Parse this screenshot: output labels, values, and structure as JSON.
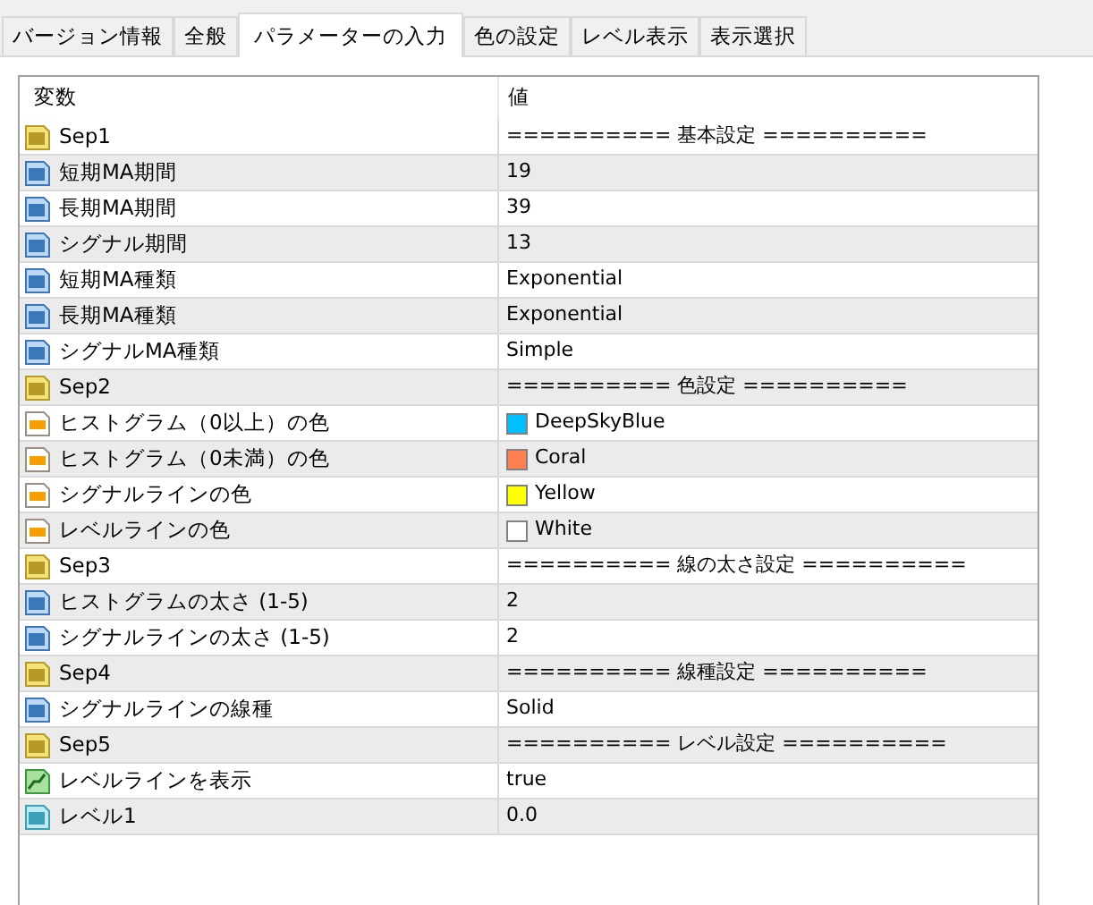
{
  "tabs": [
    {
      "label": "バージョン情報",
      "selected": false
    },
    {
      "label": "全般",
      "selected": false
    },
    {
      "label": "パラメーターの入力",
      "selected": true
    },
    {
      "label": "色の設定",
      "selected": false
    },
    {
      "label": "レベル表示",
      "selected": false
    },
    {
      "label": "表示選択",
      "selected": false
    }
  ],
  "table": {
    "columns": [
      "変数",
      "値"
    ],
    "rows": [
      {
        "kind": "string",
        "name": "Sep1",
        "value": "========== 基本設定 =========="
      },
      {
        "kind": "integer",
        "name": "短期MA期間",
        "value": "19"
      },
      {
        "kind": "integer",
        "name": "長期MA期間",
        "value": "39"
      },
      {
        "kind": "integer",
        "name": "シグナル期間",
        "value": "13"
      },
      {
        "kind": "integer",
        "name": "短期MA種類",
        "value": "Exponential"
      },
      {
        "kind": "integer",
        "name": "長期MA種類",
        "value": "Exponential"
      },
      {
        "kind": "integer",
        "name": "シグナルMA種類",
        "value": "Simple"
      },
      {
        "kind": "string",
        "name": "Sep2",
        "value": "========== 色設定 =========="
      },
      {
        "kind": "color",
        "name": "ヒストグラム（0以上）の色",
        "value": "DeepSkyBlue",
        "color": "#00bfff"
      },
      {
        "kind": "color",
        "name": "ヒストグラム（0未満）の色",
        "value": "Coral",
        "color": "#ff7f50"
      },
      {
        "kind": "color",
        "name": "シグナルラインの色",
        "value": "Yellow",
        "color": "#ffff00"
      },
      {
        "kind": "color",
        "name": "レベルラインの色",
        "value": "White",
        "color": "#ffffff"
      },
      {
        "kind": "string",
        "name": "Sep3",
        "value": "========== 線の太さ設定 =========="
      },
      {
        "kind": "integer",
        "name": "ヒストグラムの太さ (1-5)",
        "value": "2"
      },
      {
        "kind": "integer",
        "name": "シグナルラインの太さ (1-5)",
        "value": "2"
      },
      {
        "kind": "string",
        "name": "Sep4",
        "value": "========== 線種設定 =========="
      },
      {
        "kind": "integer",
        "name": "シグナルラインの線種",
        "value": "Solid"
      },
      {
        "kind": "string",
        "name": "Sep5",
        "value": "========== レベル設定 =========="
      },
      {
        "kind": "boolean",
        "name": "レベルラインを表示",
        "value": "true"
      },
      {
        "kind": "double",
        "name": "レベル1",
        "value": "0.0"
      }
    ]
  }
}
